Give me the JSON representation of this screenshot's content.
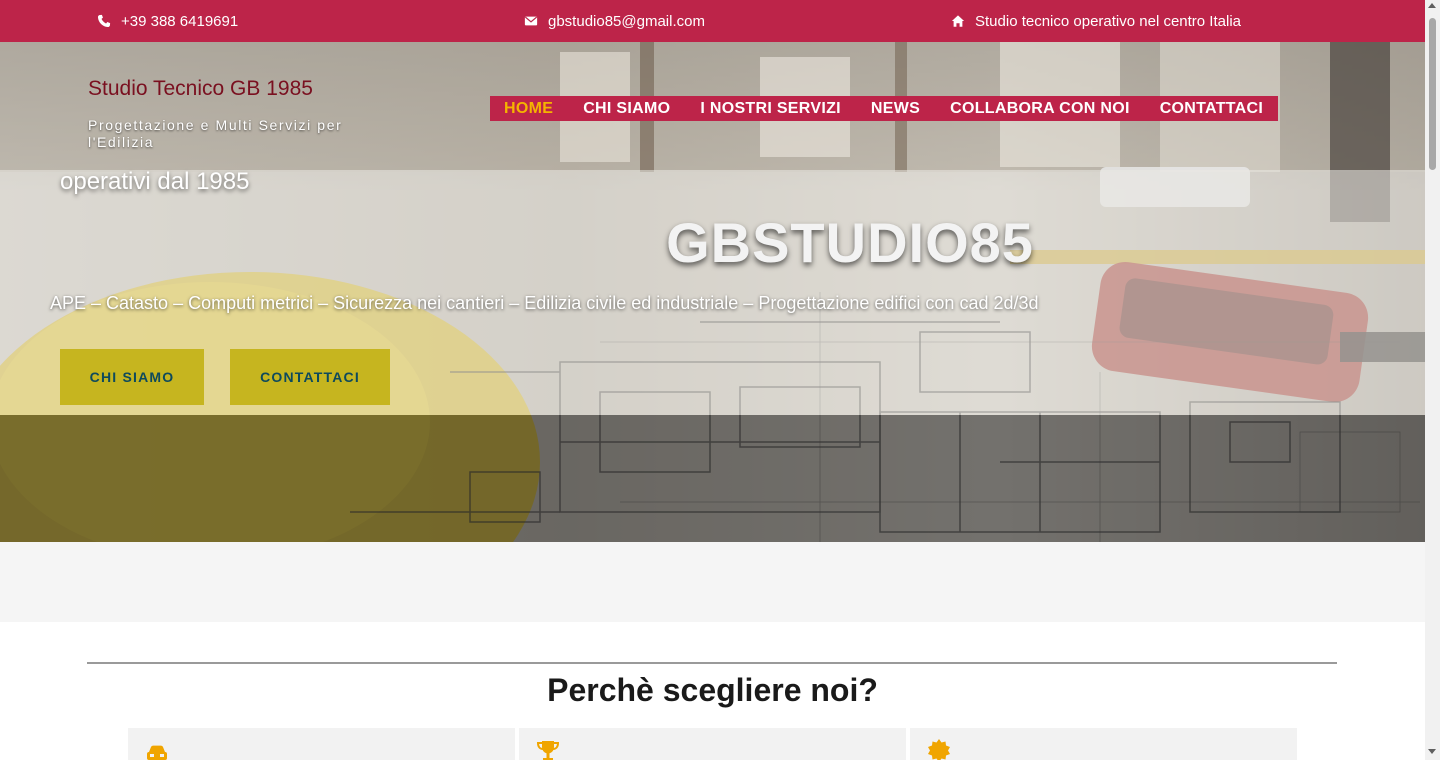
{
  "topbar": {
    "phone": "+39 388 6419691",
    "email": "gbstudio85@gmail.com",
    "location": "Studio tecnico operativo nel centro Italia",
    "phone_icon": "phone-icon",
    "email_icon": "envelope-icon",
    "location_icon": "home-icon"
  },
  "brand": {
    "title": "Studio Tecnico GB 1985",
    "subtitle": "Progettazione e Multi Servizi per l'Edilizia"
  },
  "nav": {
    "items": [
      {
        "label": "HOME"
      },
      {
        "label": "CHI SIAMO"
      },
      {
        "label": "I NOSTRI SERVIZI"
      },
      {
        "label": "NEWS"
      },
      {
        "label": "COLLABORA CON NOI"
      },
      {
        "label": "CONTATTACI"
      }
    ],
    "active": "HOME"
  },
  "hero": {
    "since": "operativi dal 1985",
    "title": "GBSTUDIO85",
    "subtitle": "APE – Catasto – Computi metrici – Sicurezza nei cantieri – Edilizia civile ed industriale – Progettazione edifici con cad 2d/3d",
    "button_about": "CHI SIAMO",
    "button_contact": "CONTATTACI"
  },
  "why": {
    "title": "Perchè scegliere noi?",
    "cards": [
      {
        "icon": "car-icon"
      },
      {
        "icon": "trophy-icon"
      },
      {
        "icon": "certificate-icon"
      }
    ]
  },
  "colors": {
    "primary": "#bd2449",
    "accent": "#f4b400",
    "button_bg": "#c6b51f",
    "button_text": "#0e4a5c",
    "brand_title": "#7a1020"
  }
}
